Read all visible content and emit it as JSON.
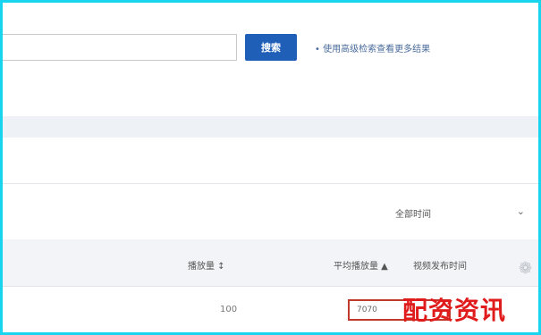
{
  "search": {
    "placeholder": "",
    "button_label": "搜索",
    "hint": "• 使用高级检索查看更多结果"
  },
  "filter": {
    "dropdown_value": "全部时间"
  },
  "table": {
    "headers": [
      "播放量 ↕",
      "平均播放量 ▲",
      "视频发布时间"
    ],
    "rows": [
      {
        "play_count": "100",
        "boxed_value": "7070"
      }
    ]
  },
  "watermark": "配资资讯",
  "icons": {
    "dropdown": "chevron-down-icon",
    "side": "logo-icon"
  },
  "colors": {
    "frame": "#19d4ee",
    "accent": "#1f5fb8",
    "highlight_box": "#c0392b",
    "watermark": "#e01b1b"
  }
}
